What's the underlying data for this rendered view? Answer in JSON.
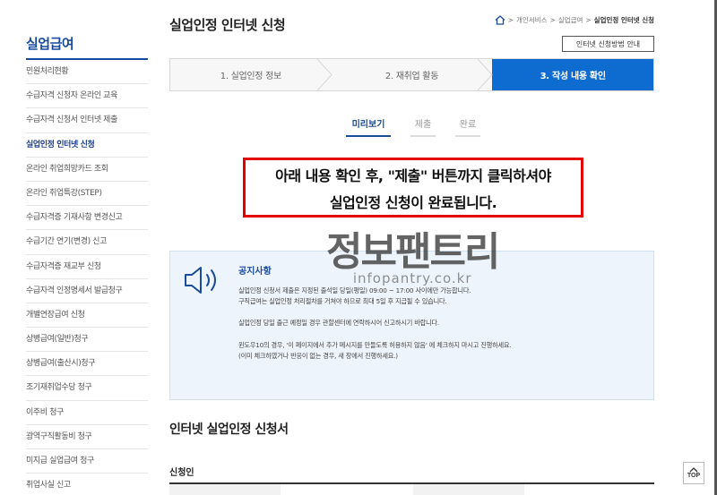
{
  "sidebar": {
    "title": "실업급여",
    "items": [
      {
        "label": "민원처리현황",
        "active": false
      },
      {
        "label": "수급자격 신청자 온라인 교육",
        "active": false
      },
      {
        "label": "수급자격 신청서 인터넷 제출",
        "active": false
      },
      {
        "label": "실업인정 인터넷 신청",
        "active": true
      },
      {
        "label": "온라인 취업희망카드 조회",
        "active": false
      },
      {
        "label": "온라인 취업특강(STEP)",
        "active": false
      },
      {
        "label": "수급자격증 기재사항 변경신고",
        "active": false
      },
      {
        "label": "수급기간 연기(변경) 신고",
        "active": false
      },
      {
        "label": "수급자격증 재교부 신청",
        "active": false
      },
      {
        "label": "수급자격 인정명세서 발급청구",
        "active": false
      },
      {
        "label": "개별연장급여 신청",
        "active": false
      },
      {
        "label": "상병급여(일반)청구",
        "active": false
      },
      {
        "label": "상병급여(출산시)청구",
        "active": false
      },
      {
        "label": "조기재취업수당 청구",
        "active": false
      },
      {
        "label": "이주비 청구",
        "active": false
      },
      {
        "label": "광역구직활동비 청구",
        "active": false
      },
      {
        "label": "미지급 실업급여 청구",
        "active": false
      },
      {
        "label": "취업사실 신고",
        "active": false
      }
    ]
  },
  "header": {
    "title": "실업인정 인터넷 신청",
    "breadcrumb": [
      "개인서비스",
      "실업급여",
      "실업인정 인터넷 신청"
    ],
    "guide_button": "인터넷 신청방법 안내"
  },
  "steps": [
    {
      "label": "1. 실업인정 정보",
      "active": false
    },
    {
      "label": "2. 재취업 활동",
      "active": false
    },
    {
      "label": "3. 작성 내용 확인",
      "active": true
    }
  ],
  "subtabs": [
    {
      "label": "미리보기",
      "active": true
    },
    {
      "label": "제출",
      "active": false
    },
    {
      "label": "완료",
      "active": false
    }
  ],
  "red_notice": {
    "line1": "아래 내용 확인 후, \"제출\" 버튼까지 클릭하셔야",
    "line2": "실업인정 신청이 완료됩니다."
  },
  "watermark": {
    "big": "정보팬트리",
    "small": "infopantry.co.kr"
  },
  "notice": {
    "title": "공지사항",
    "lines": [
      "실업인정 신청서 제출은 지정된 출석일 당일(평일) 09:00 ~ 17:00 사이에만 가능합니다.",
      "구직급여는 실업인정 처리절차를 거쳐야 하므로 최대 5일 후 지급될 수 있습니다.",
      "실업인정 당일 출근 예정일 경우 관할센터에 연락하시어 신고하시기 바랍니다.",
      "윈도우10의 경우, '이 페이지에서 추가 메시지를 만들도록 허용하지 않음' 에 체크하지 마시고 진행하세요.",
      "(이미 체크하였거나 반응이 없는 경우, 새 창에서 진행하세요.)"
    ]
  },
  "section": {
    "title": "인터넷 실업인정 신청서",
    "applicant_label": "신청인"
  },
  "top_button": "TOP",
  "colors": {
    "brand_blue": "#1a4a9c",
    "step_active": "#0e6cd0",
    "notice_red": "#e20000",
    "notice_bg": "#eef4fb"
  }
}
